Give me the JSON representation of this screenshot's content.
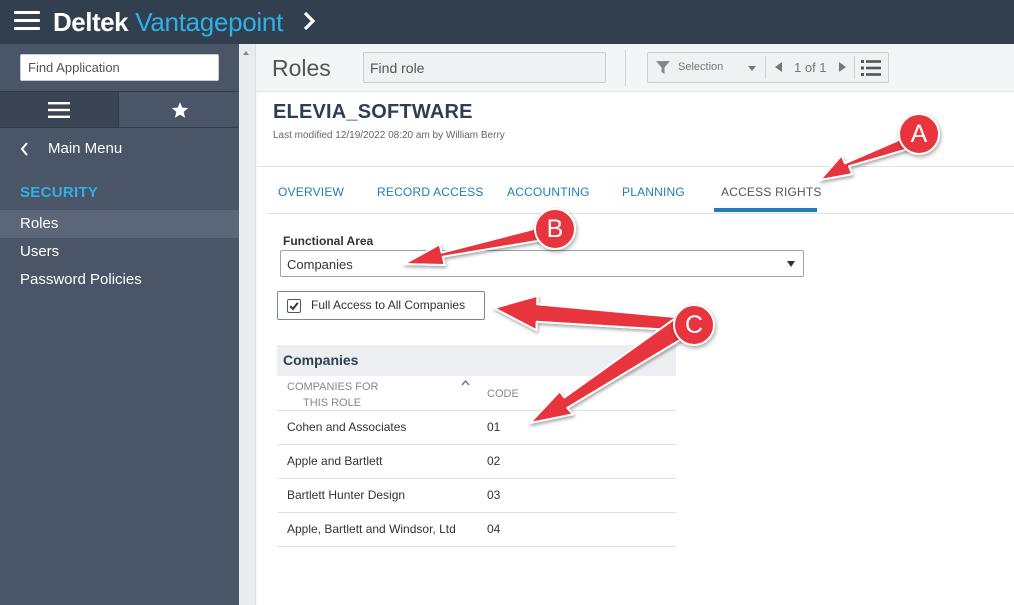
{
  "header": {
    "brand_primary": "Deltek",
    "brand_secondary": "Vantagepoint"
  },
  "sidebar": {
    "find_placeholder": "Find Application",
    "main_menu": "Main Menu",
    "section": "SECURITY",
    "items": [
      {
        "label": "Roles",
        "active": true
      },
      {
        "label": "Users",
        "active": false
      },
      {
        "label": "Password Policies",
        "active": false
      }
    ]
  },
  "toolbar": {
    "title": "Roles",
    "find_placeholder": "Find role",
    "selection_label": "Selection",
    "pager": "1 of 1"
  },
  "record": {
    "name": "ELEVIA_SOFTWARE",
    "modified": "Last modified 12/19/2022 08:20 am by William Berry"
  },
  "tabs": [
    "OVERVIEW",
    "RECORD ACCESS",
    "ACCOUNTING",
    "PLANNING",
    "ACCESS RIGHTS"
  ],
  "active_tab": "ACCESS RIGHTS",
  "functional_area": {
    "label": "Functional Area",
    "value": "Companies"
  },
  "full_access": {
    "label": "Full Access to All Companies",
    "checked": true
  },
  "companies_grid": {
    "title": "Companies",
    "col_name_line1": "COMPANIES FOR",
    "col_name_line2": "THIS ROLE",
    "col_code": "CODE",
    "rows": [
      {
        "name": "Cohen and Associates",
        "code": "01"
      },
      {
        "name": "Apple and Bartlett",
        "code": "02"
      },
      {
        "name": "Bartlett Hunter Design",
        "code": "03"
      },
      {
        "name": "Apple, Bartlett and Windsor, Ltd",
        "code": "04"
      }
    ]
  },
  "callouts": [
    "A",
    "B",
    "C"
  ],
  "colors": {
    "topbar": "#323f4f",
    "sidebar": "#4a5567",
    "accent": "#2fb0e8",
    "tab_link": "#1e7fb0",
    "callout": "#e8353d"
  }
}
